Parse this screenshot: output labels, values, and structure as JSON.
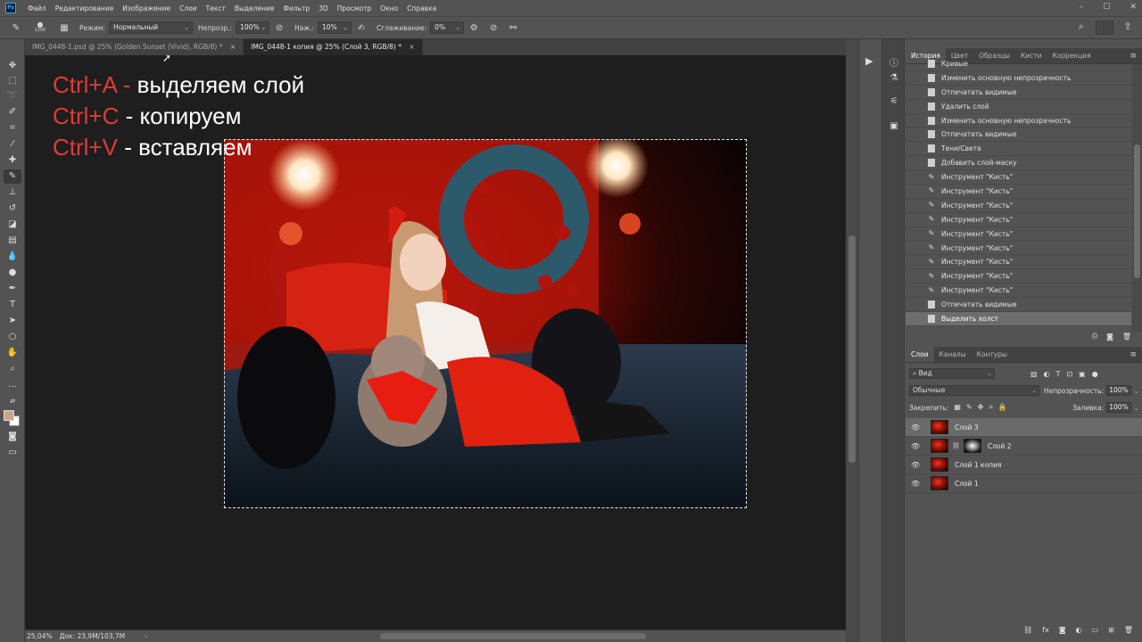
{
  "menu": {
    "items": [
      "Файл",
      "Редактирование",
      "Изображение",
      "Слои",
      "Текст",
      "Выделение",
      "Фильтр",
      "3D",
      "Просмотр",
      "Окно",
      "Справка"
    ]
  },
  "options_bar": {
    "brush_size": "1200",
    "mode_label": "Режим:",
    "mode_value": "Нормальный",
    "opacity_label": "Непрозр.:",
    "opacity_value": "100%",
    "flow_label": "Наж.:",
    "flow_value": "10%",
    "smoothing_label": "Сглаживание:",
    "smoothing_value": "0%"
  },
  "tabs": [
    {
      "label": "IMG_0448-1.psd @ 25% (Golden Sunset  (Vivid), RGB/8) *",
      "close": "×"
    },
    {
      "label": "IMG_0448-1 копия @ 25% (Слой 3, RGB/8) *",
      "close": "×"
    }
  ],
  "overlay": {
    "line1_key": "Ctrl+A -",
    "line1_text": " выделяем слой",
    "line2_key": "Ctrl+C",
    "line2_text": " - копируем",
    "line3_key": "Ctrl+V",
    "line3_text": " - вставляем"
  },
  "status": {
    "zoom": "25,04%",
    "doc": "Док: 23,9M/103,7M",
    "arrow": "›"
  },
  "history_panel": {
    "tabs": [
      "История",
      "Цвет",
      "Образцы",
      "Кисти",
      "Коррекция"
    ],
    "items": [
      {
        "label": "Кривые",
        "icon": "doc"
      },
      {
        "label": "Изменить основную непрозрачность",
        "icon": "doc"
      },
      {
        "label": "Отпечатать видимые",
        "icon": "doc"
      },
      {
        "label": "Удалить слой",
        "icon": "doc"
      },
      {
        "label": "Изменить основную непрозрачность",
        "icon": "doc"
      },
      {
        "label": "Отпечатать видимые",
        "icon": "doc"
      },
      {
        "label": "Тени/Света",
        "icon": "doc"
      },
      {
        "label": "Добавить слой-маску",
        "icon": "doc"
      },
      {
        "label": "Инструмент \"Кисть\"",
        "icon": "brush"
      },
      {
        "label": "Инструмент \"Кисть\"",
        "icon": "brush"
      },
      {
        "label": "Инструмент \"Кисть\"",
        "icon": "brush"
      },
      {
        "label": "Инструмент \"Кисть\"",
        "icon": "brush"
      },
      {
        "label": "Инструмент \"Кисть\"",
        "icon": "brush"
      },
      {
        "label": "Инструмент \"Кисть\"",
        "icon": "brush"
      },
      {
        "label": "Инструмент \"Кисть\"",
        "icon": "brush"
      },
      {
        "label": "Инструмент \"Кисть\"",
        "icon": "brush"
      },
      {
        "label": "Инструмент \"Кисть\"",
        "icon": "brush"
      },
      {
        "label": "Отпечатать видимые",
        "icon": "doc"
      },
      {
        "label": "Выделить холст",
        "icon": "doc",
        "selected": true
      }
    ]
  },
  "layers_panel": {
    "tabs": [
      "Слои",
      "Каналы",
      "Контуры"
    ],
    "filter_label": "Вид",
    "blend_mode": "Обычные",
    "opacity_label": "Непрозрачность:",
    "opacity_value": "100%",
    "lock_label": "Закрепить:",
    "fill_label": "Заливка:",
    "fill_value": "100%",
    "layers": [
      {
        "name": "Слой 3",
        "selected": true,
        "mask": false
      },
      {
        "name": "Слой 2",
        "selected": false,
        "mask": true
      },
      {
        "name": "Слой 1 копия",
        "selected": false,
        "mask": false
      },
      {
        "name": "Слой 1",
        "selected": false,
        "mask": false
      }
    ]
  }
}
